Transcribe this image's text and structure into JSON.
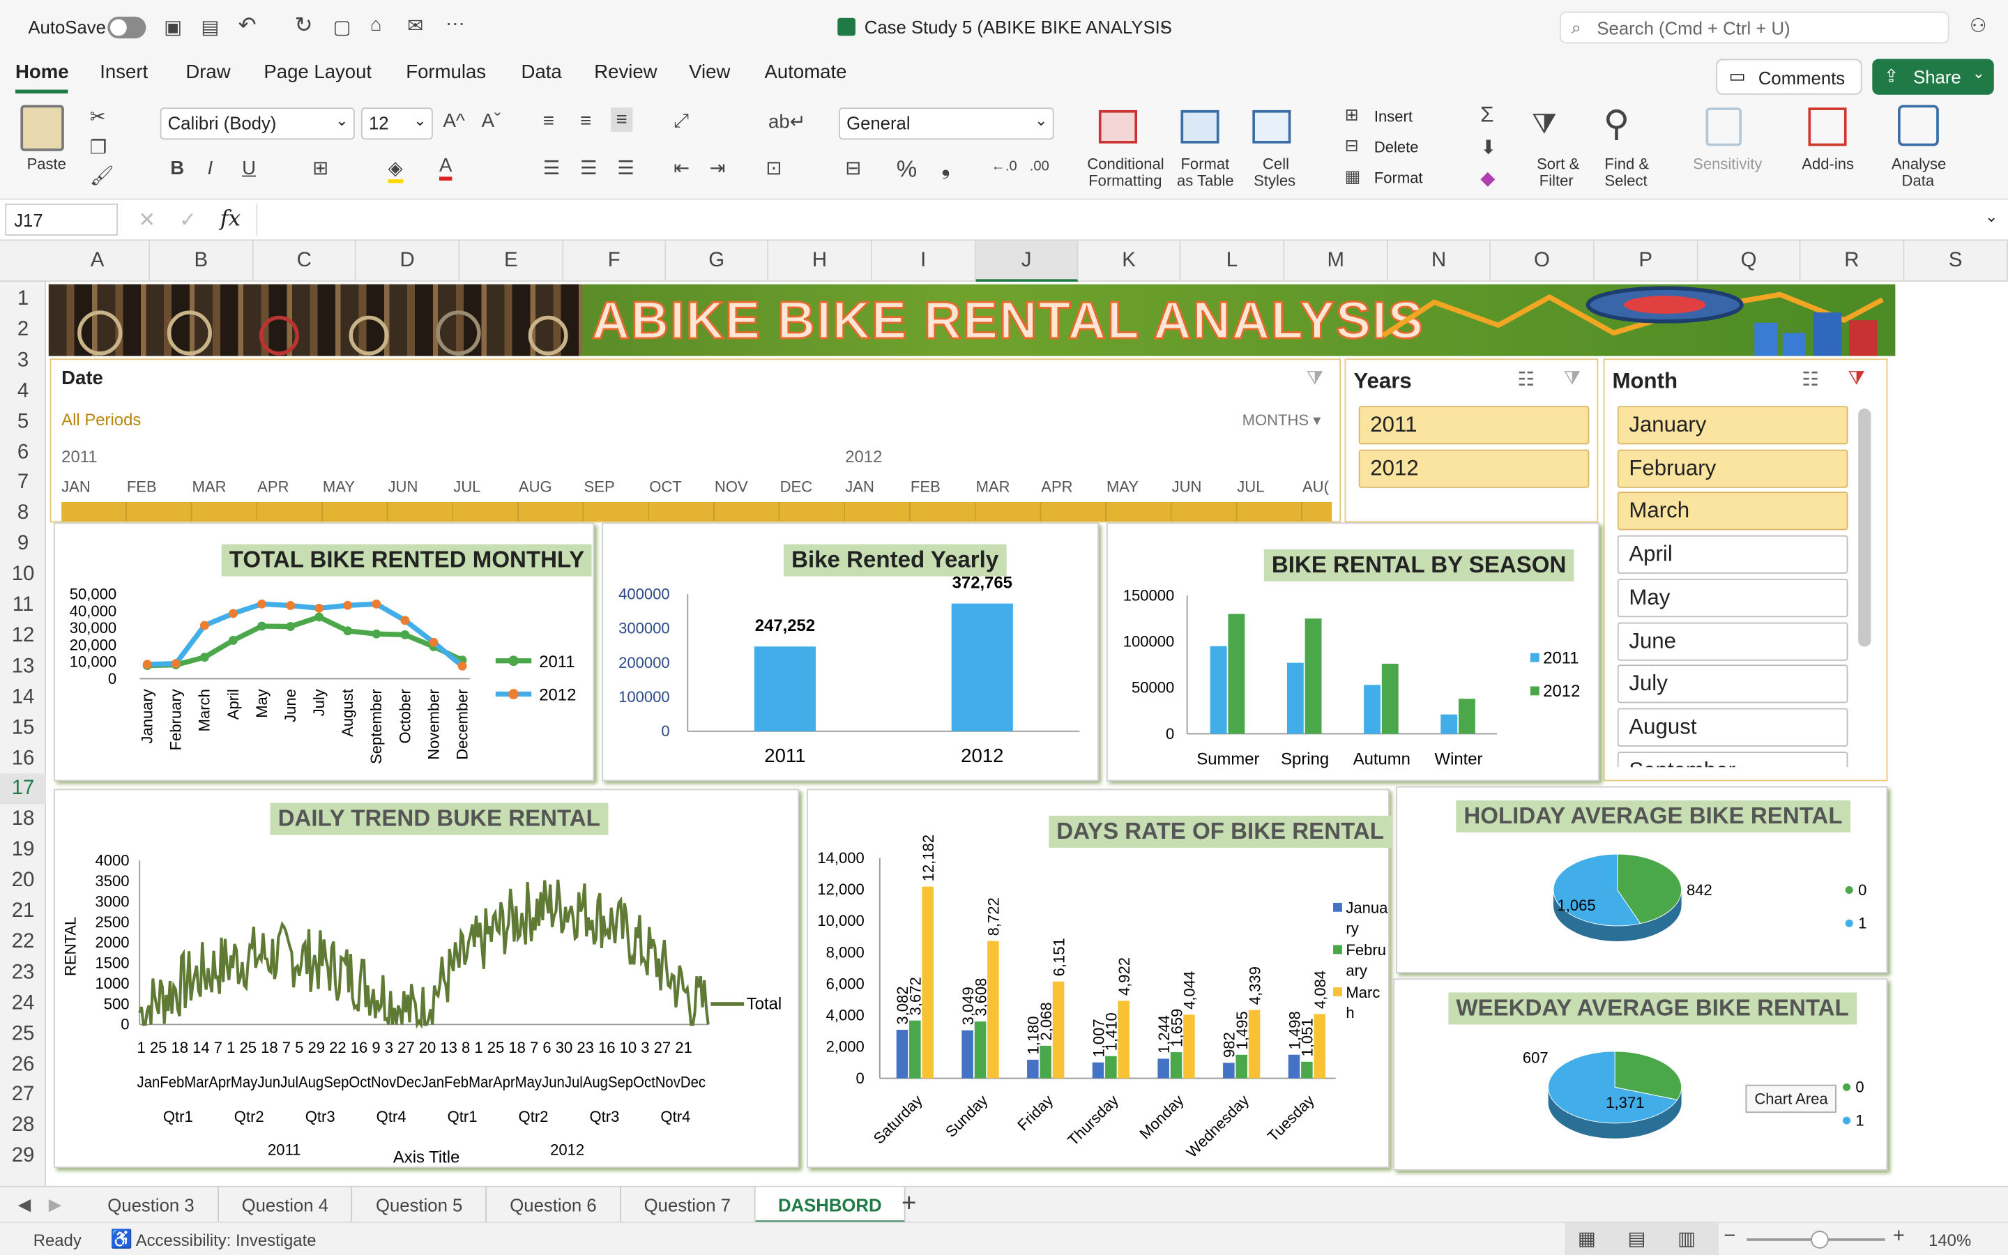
{
  "titlebar": {
    "autosave": "AutoSave",
    "doc": "Case Study 5 (ABIKE BIKE ANALYSIS",
    "search": "Search (Cmd + Ctrl + U)"
  },
  "tabs": [
    "Home",
    "Insert",
    "Draw",
    "Page Layout",
    "Formulas",
    "Data",
    "Review",
    "View",
    "Automate"
  ],
  "comments": "Comments",
  "share": "Share",
  "ribbon": {
    "paste": "Paste",
    "font": "Calibri (Body)",
    "size": "12",
    "numfmt": "General",
    "cond": "Conditional",
    "cond2": "Formatting",
    "fmt": "Format",
    "fmt2": "as Table",
    "cell": "Cell",
    "cell2": "Styles",
    "insert": "Insert",
    "delete": "Delete",
    "format": "Format",
    "sort": "Sort &",
    "sort2": "Filter",
    "find": "Find &",
    "find2": "Select",
    "sens": "Sensitivity",
    "addins": "Add-ins",
    "an": "Analyse",
    "an2": "Data"
  },
  "namebox": "J17",
  "fx": "fx",
  "columns": [
    "A",
    "B",
    "C",
    "D",
    "E",
    "F",
    "G",
    "H",
    "I",
    "J",
    "K",
    "L",
    "M",
    "N",
    "O",
    "P",
    "Q",
    "R",
    "S"
  ],
  "rows": [
    "1",
    "2",
    "3",
    "4",
    "5",
    "6",
    "7",
    "8",
    "9",
    "10",
    "11",
    "12",
    "13",
    "14",
    "15",
    "16",
    "17",
    "18",
    "19",
    "20",
    "21",
    "22",
    "23",
    "24",
    "25",
    "26",
    "27",
    "28",
    "29"
  ],
  "banner": "ABIKE BIKE RENTAL ANALYSIS",
  "timeline": {
    "title": "Date",
    "period": "All Periods",
    "unit": "MONTHS",
    "y1": "2011",
    "y2": "2012",
    "months": [
      "JAN",
      "FEB",
      "MAR",
      "APR",
      "MAY",
      "JUN",
      "JUL",
      "AUG",
      "SEP",
      "OCT",
      "NOV",
      "DEC",
      "JAN",
      "FEB",
      "MAR",
      "APR",
      "MAY",
      "JUN",
      "JUL",
      "AU("
    ]
  },
  "years_slicer": {
    "title": "Years",
    "items": [
      "2011",
      "2012"
    ]
  },
  "month_slicer": {
    "title": "Month",
    "items": [
      "January",
      "February",
      "March",
      "April",
      "May",
      "June",
      "July",
      "August",
      "September"
    ]
  },
  "chart_monthly": {
    "title": "TOTAL BIKE RENTED MONTHLY",
    "yticks": [
      "50,000",
      "40,000",
      "30,000",
      "20,000",
      "10,000",
      "0"
    ],
    "categories": [
      "January",
      "February",
      "March",
      "April",
      "May",
      "June",
      "July",
      "August",
      "September",
      "October",
      "November",
      "December"
    ],
    "legend": [
      "2011",
      "2012"
    ]
  },
  "chart_yearly": {
    "title": "Bike Rented Yearly",
    "yticks": [
      "400000",
      "300000",
      "200000",
      "100000",
      "0"
    ],
    "categories": [
      "2011",
      "2012"
    ],
    "labels": [
      "247,252",
      "372,765"
    ]
  },
  "chart_season": {
    "title": "BIKE RENTAL BY SEASON",
    "yticks": [
      "150000",
      "100000",
      "50000",
      "0"
    ],
    "categories": [
      "Summer",
      "Spring",
      "Autumn",
      "Winter"
    ],
    "legend": [
      "2011",
      "2012"
    ]
  },
  "chart_daily": {
    "title": "DAILY TREND BUKE RENTAL",
    "ylabel": "RENTAL",
    "yticks": [
      "4000",
      "3500",
      "3000",
      "2500",
      "2000",
      "1500",
      "1000",
      "500",
      "0"
    ],
    "legend": "Total",
    "xaxis_title": "Axis Title",
    "days": "1 25 18 14  7  1 25 18  7  5 29 22 16  9  3 27 20 13  8  1 25 18  7  6 30 23 16 10  3 27 21",
    "months": "JanFebMarAprMayJunJulAugSepOctNovDecJanFebMarAprMayJunJulAugSepOctNovDec",
    "qtrs": [
      "Qtr1",
      "Qtr2",
      "Qtr3",
      "Qtr4",
      "Qtr1",
      "Qtr2",
      "Qtr3",
      "Qtr4"
    ],
    "years": [
      "2011",
      "2012"
    ]
  },
  "chart_days": {
    "title": "DAYS RATE OF BIKE RENTAL",
    "yticks": [
      "14,000",
      "12,000",
      "10,000",
      "8,000",
      "6,000",
      "4,000",
      "2,000",
      "0"
    ],
    "categories": [
      "Saturday",
      "Sunday",
      "Friday",
      "Thursday",
      "Monday",
      "Wednesday",
      "Tuesday"
    ],
    "legend": [
      "Janua ry",
      "Febru ary",
      "Marc h"
    ],
    "labels": [
      [
        "3,082",
        "3,672",
        "12,182"
      ],
      [
        "3,049",
        "3,608",
        "8,722"
      ],
      [
        "1,180",
        "2,068",
        "6,151"
      ],
      [
        "1,007",
        "1,410",
        "4,922"
      ],
      [
        "1,244",
        "1,659",
        "4,044"
      ],
      [
        "982",
        "1,495",
        "4,339"
      ],
      [
        "1,498",
        "1,051",
        "4,084"
      ]
    ]
  },
  "chart_holiday": {
    "title": "HOLIDAY AVERAGE BIKE RENTAL",
    "labels": [
      "1,065",
      "842"
    ],
    "legend": [
      "0",
      "1"
    ]
  },
  "chart_weekday": {
    "title": "WEEKDAY AVERAGE BIKE RENTAL",
    "labels": [
      "607",
      "1,371"
    ],
    "legend": [
      "0",
      "1"
    ],
    "tooltip": "Chart Area"
  },
  "sheets": [
    "Question 3",
    "Question 4",
    "Question 5",
    "Question 6",
    "Question 7",
    "DASHBORD"
  ],
  "status": {
    "ready": "Ready",
    "access": "Accessibility: Investigate",
    "zoom": "140%"
  },
  "chart_data": [
    {
      "type": "line",
      "title": "TOTAL BIKE RENTED MONTHLY",
      "categories": [
        "January",
        "February",
        "March",
        "April",
        "May",
        "June",
        "July",
        "August",
        "September",
        "October",
        "November",
        "December"
      ],
      "ylim": [
        0,
        50000
      ],
      "series": [
        {
          "name": "2011",
          "values": [
            7800,
            8200,
            12700,
            22700,
            31100,
            30900,
            36500,
            28300,
            26500,
            26000,
            19000,
            11000
          ]
        },
        {
          "name": "2012",
          "values": [
            8500,
            9000,
            31500,
            38600,
            44200,
            43300,
            41700,
            43400,
            44200,
            34500,
            21500,
            7500
          ]
        }
      ]
    },
    {
      "type": "bar",
      "title": "Bike Rented Yearly",
      "categories": [
        "2011",
        "2012"
      ],
      "values": [
        247252,
        372765
      ],
      "ylim": [
        0,
        400000
      ]
    },
    {
      "type": "bar",
      "title": "BIKE RENTAL BY SEASON",
      "categories": [
        "Summer",
        "Spring",
        "Autumn",
        "Winter"
      ],
      "ylim": [
        0,
        150000
      ],
      "series": [
        {
          "name": "2011",
          "values": [
            95000,
            77000,
            53000,
            21000
          ]
        },
        {
          "name": "2012",
          "values": [
            130000,
            125000,
            76000,
            38000
          ]
        }
      ]
    },
    {
      "type": "bar",
      "title": "DAYS RATE OF BIKE RENTAL",
      "categories": [
        "Saturday",
        "Sunday",
        "Friday",
        "Thursday",
        "Monday",
        "Wednesday",
        "Tuesday"
      ],
      "ylim": [
        0,
        14000
      ],
      "series": [
        {
          "name": "January",
          "values": [
            3082,
            3049,
            1180,
            1007,
            1244,
            982,
            1498
          ]
        },
        {
          "name": "February",
          "values": [
            3672,
            3608,
            2068,
            1410,
            1659,
            1495,
            1051
          ]
        },
        {
          "name": "March",
          "values": [
            12182,
            8722,
            6151,
            4922,
            4044,
            4339,
            4084
          ]
        }
      ]
    },
    {
      "type": "pie",
      "title": "HOLIDAY AVERAGE BIKE RENTAL",
      "categories": [
        "0",
        "1"
      ],
      "values": [
        842,
        1065
      ]
    },
    {
      "type": "pie",
      "title": "WEEKDAY AVERAGE BIKE RENTAL",
      "categories": [
        "0",
        "1"
      ],
      "values": [
        607,
        1371
      ]
    }
  ],
  "colors": {
    "green": "#4aa84a",
    "blue": "#41aeea",
    "orange": "#ed7d31",
    "olive": "#5f7a34",
    "yellow": "#f9c134",
    "darkblue": "#4472c4",
    "excel": "#1f7a45"
  }
}
